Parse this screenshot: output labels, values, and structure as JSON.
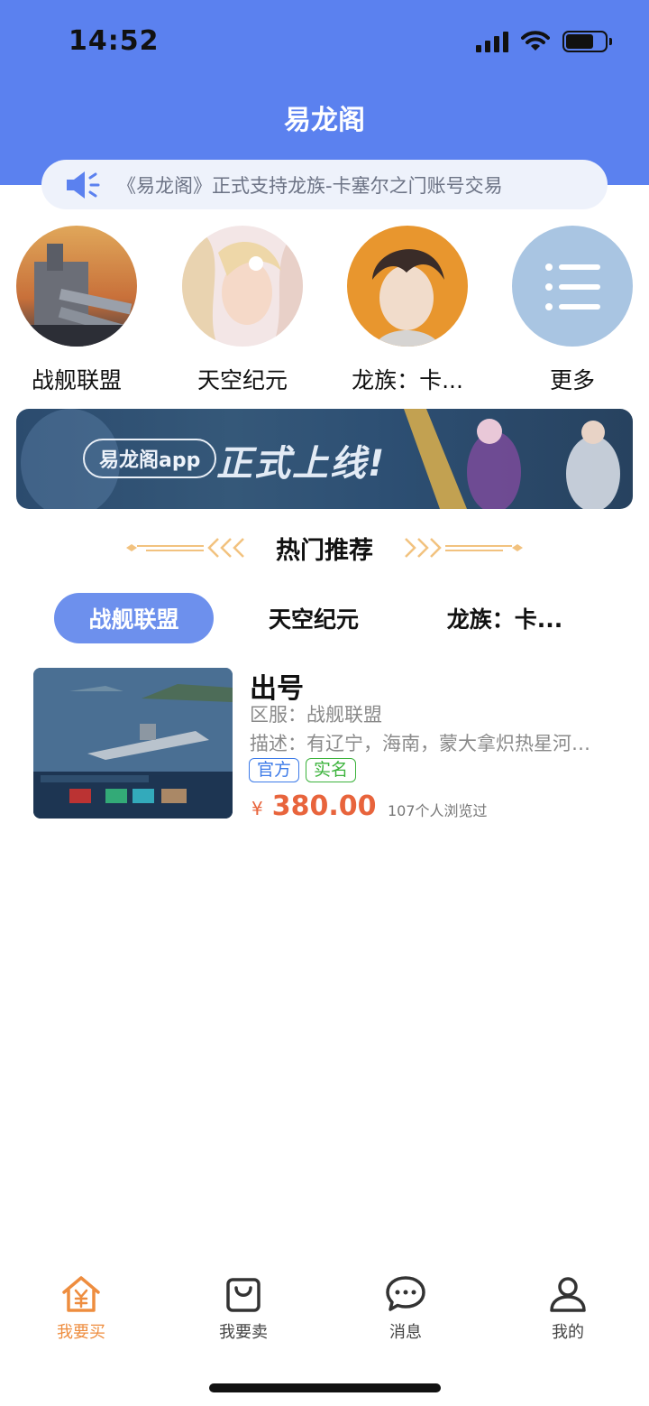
{
  "status_bar": {
    "time": "14:52"
  },
  "header": {
    "title": "易龙阁"
  },
  "notice": {
    "text": "《易龙阁》正式支持龙族-卡塞尔之门账号交易"
  },
  "games": [
    {
      "label": "战舰联盟"
    },
    {
      "label": "天空纪元"
    },
    {
      "label": "龙族：卡..."
    },
    {
      "label": "更多"
    }
  ],
  "banner": {
    "pill": "易龙阁app",
    "headline": "正式上线!"
  },
  "section": {
    "title": "热门推荐"
  },
  "tabs": [
    {
      "label": "战舰联盟",
      "active": true
    },
    {
      "label": "天空纪元",
      "active": false
    },
    {
      "label": "龙族：卡...",
      "active": false
    }
  ],
  "listing": {
    "title": "出号",
    "server": "区服：战舰联盟",
    "description": "描述：有辽宁，海南，蒙大拿炽热星河…",
    "tags": [
      "官方",
      "实名"
    ],
    "currency": "¥",
    "price": "380.00",
    "views": "107个人浏览过"
  },
  "tabbar": [
    {
      "label": "我要买",
      "icon": "home-yen-icon",
      "active": true
    },
    {
      "label": "我要卖",
      "icon": "shopping-bag-icon",
      "active": false
    },
    {
      "label": "消息",
      "icon": "chat-bubble-icon",
      "active": false
    },
    {
      "label": "我的",
      "icon": "user-icon",
      "active": false
    }
  ],
  "colors": {
    "header": "#5b81ef",
    "accent": "#ee8d3f",
    "price": "#e8643c",
    "tab_active": "#6d90ed"
  }
}
